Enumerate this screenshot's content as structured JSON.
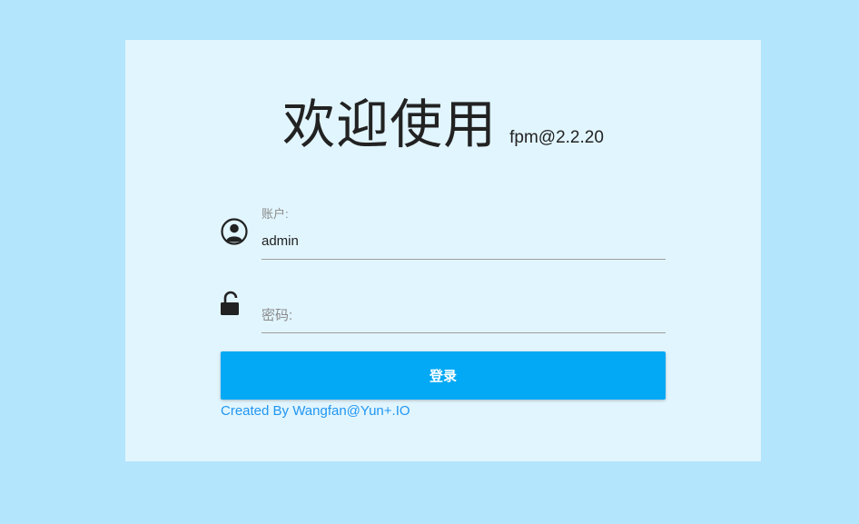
{
  "header": {
    "title": "欢迎使用",
    "version": "fpm@2.2.20"
  },
  "form": {
    "account": {
      "label": "账户:",
      "value": "admin",
      "icon": "account-circle-icon"
    },
    "password": {
      "label": "密码:",
      "value": "",
      "icon": "lock-open-icon"
    },
    "submit_label": "登录"
  },
  "footer": {
    "credit": "Created By Wangfan@Yun+.IO"
  },
  "colors": {
    "page_background": "#b3e5fc",
    "card_background": "#e1f5fe",
    "primary": "#03a9f4",
    "link": "#2196f3"
  }
}
